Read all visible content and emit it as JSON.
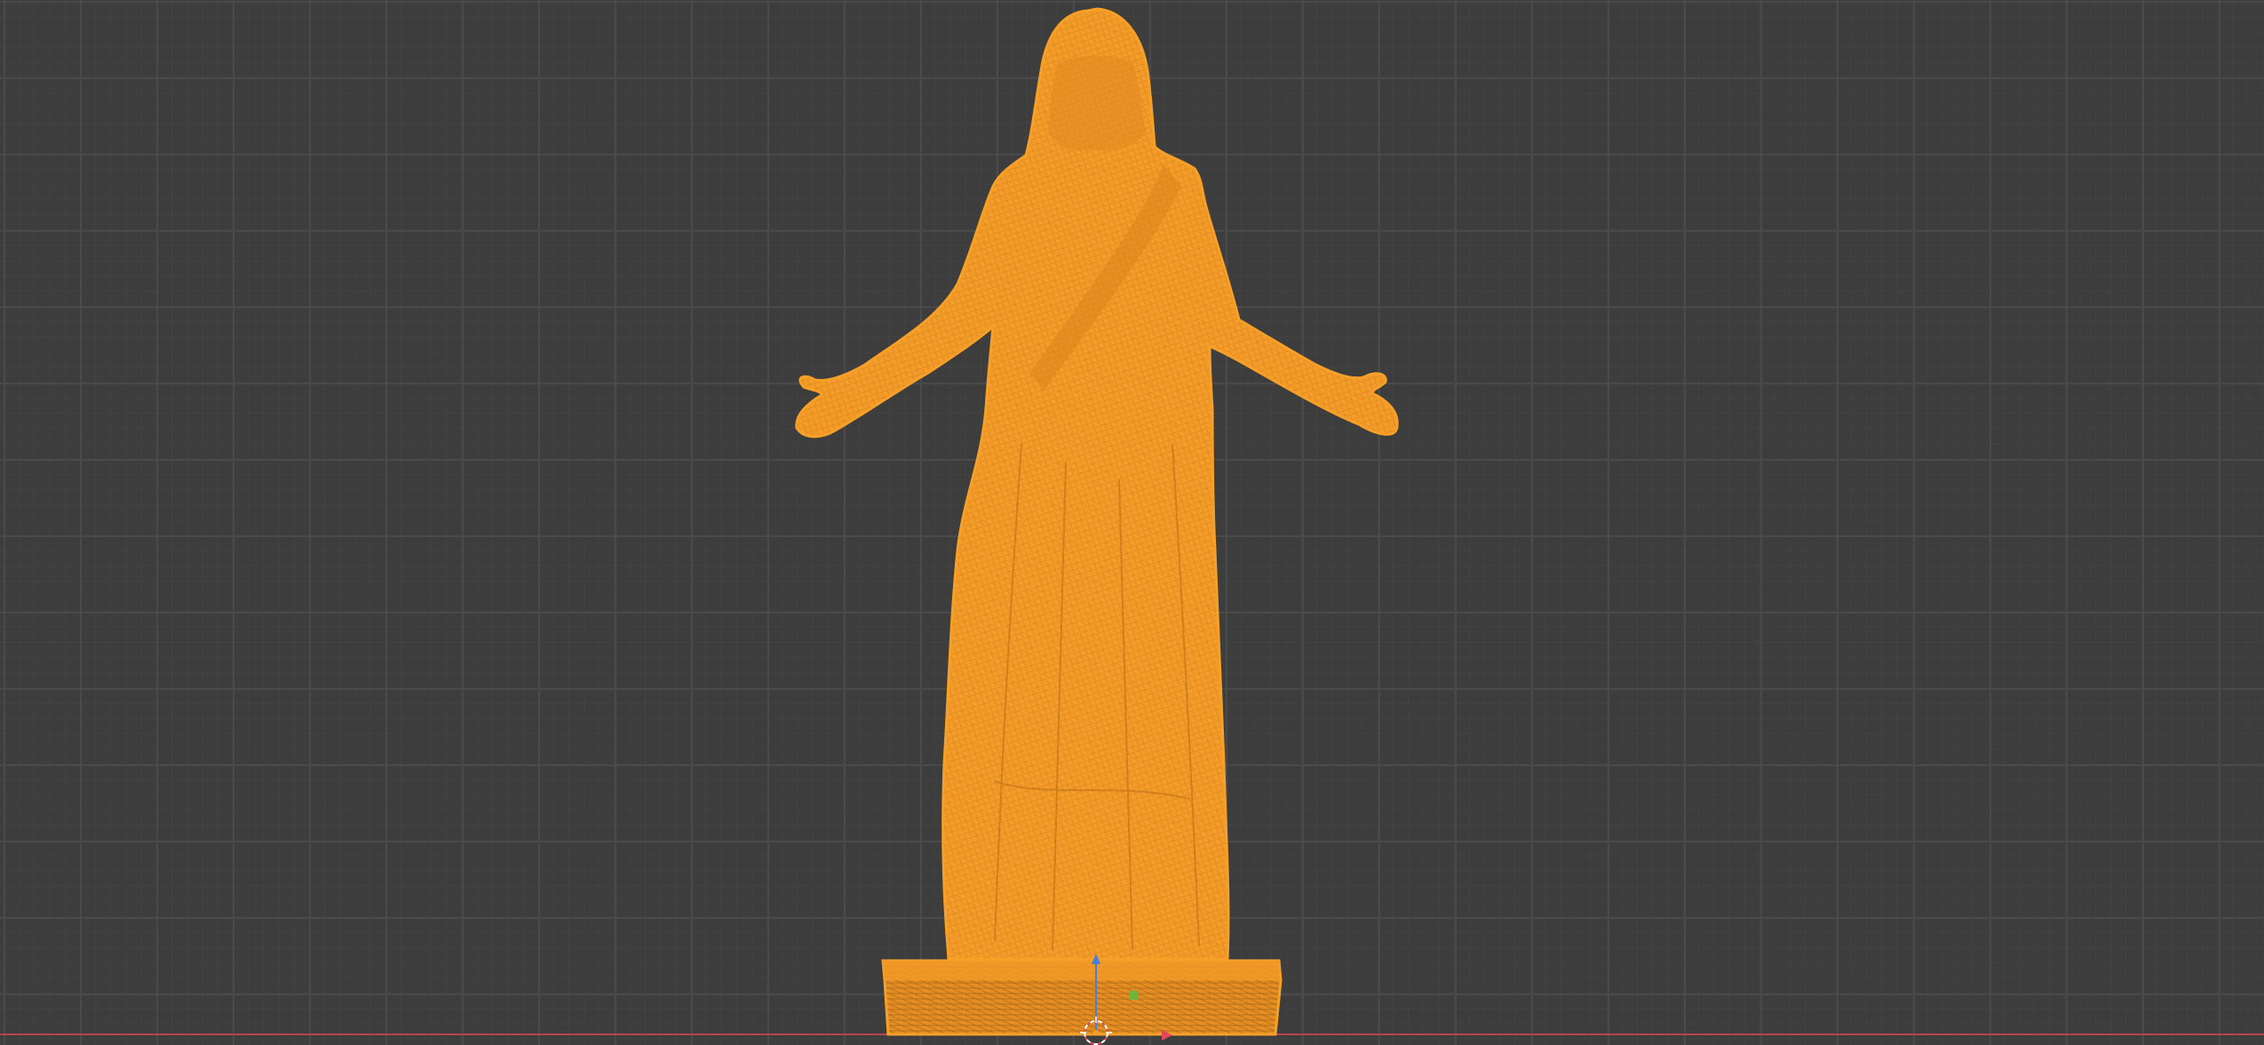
{
  "viewport": {
    "background_color": "#3d3d3d",
    "grid_color": "#4a4a4a",
    "x_axis_color": "#b8434f",
    "z_axis_color": "#4a7fd9",
    "y_axis_color": "#6fb33a"
  },
  "object": {
    "name": "statue-mesh",
    "display_mode": "wireframe",
    "selected": true,
    "selection_color": "#f7a028",
    "fill_color": "#f39a27",
    "highlight_color": "#ffb347"
  },
  "gizmos": {
    "origin": "origin-dot",
    "cursor": "3d-cursor-icon"
  }
}
